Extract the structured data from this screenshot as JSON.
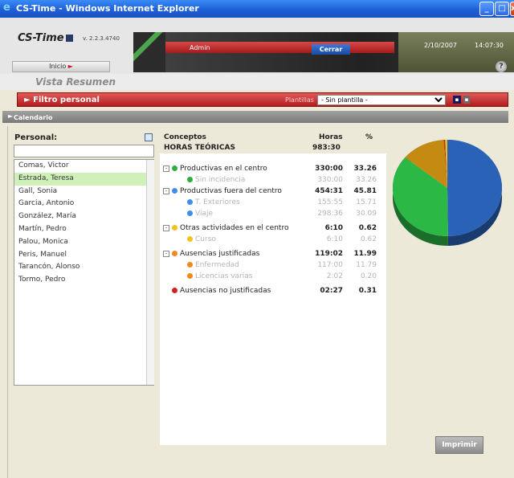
{
  "window": {
    "title": "CS-Time - Windows Internet Explorer"
  },
  "header": {
    "logo": "CS-Time",
    "version": "v. 2.2.3.4740",
    "inicio": "Inicio",
    "user": "Admin",
    "logout": "Cerrar",
    "date": "2/10/2007",
    "time": "14:07:30"
  },
  "view_title": "Vista Resumen",
  "filter": {
    "label": "Filtro personal",
    "plantillas_label": "Plantillas",
    "plantilla_value": "- Sin plantilla -"
  },
  "calendar_label": "Calendario",
  "personal": {
    "header": "Personal:",
    "search_value": "",
    "items": [
      {
        "name": "Comas, Victor",
        "selected": false
      },
      {
        "name": "Estrada, Teresa",
        "selected": true
      },
      {
        "name": "Gall, Sonia",
        "selected": false
      },
      {
        "name": "Garcia, Antonio",
        "selected": false
      },
      {
        "name": "González, María",
        "selected": false
      },
      {
        "name": "Martín, Pedro",
        "selected": false
      },
      {
        "name": "Palou, Monica",
        "selected": false
      },
      {
        "name": "Peris, Manuel",
        "selected": false
      },
      {
        "name": "Tarancón, Alonso",
        "selected": false
      },
      {
        "name": "Tormo, Pedro",
        "selected": false
      }
    ]
  },
  "conceptos": {
    "col_concepto": "Conceptos",
    "col_horas": "Horas",
    "col_pct": "%",
    "total_label": "HORAS TEÓRICAS",
    "total_horas": "983:30",
    "rows": [
      {
        "name": "Productivas en el centro",
        "horas": "330:00",
        "pct": "33.26",
        "level": 0,
        "expander": "-",
        "color": "#2eae3a",
        "style": "bold"
      },
      {
        "name": "Sin incidencia",
        "horas": "330:00",
        "pct": "33.26",
        "level": 1,
        "expander": "",
        "color": "#2eae3a",
        "style": "light"
      },
      {
        "name": "Productivas fuera del centro",
        "horas": "454:31",
        "pct": "45.81",
        "level": 0,
        "expander": "-",
        "color": "#3d8ef0",
        "style": "bold"
      },
      {
        "name": "T. Exteriores",
        "horas": "155:55",
        "pct": "15.71",
        "level": 1,
        "expander": "",
        "color": "#3d8ef0",
        "style": "light"
      },
      {
        "name": "Viaje",
        "horas": "298:36",
        "pct": "30.09",
        "level": 1,
        "expander": "",
        "color": "#3d8ef0",
        "style": "light"
      },
      {
        "name": "Otras actividades en el centro",
        "horas": "6:10",
        "pct": "0.62",
        "level": 0,
        "expander": "-",
        "color": "#f2c21a",
        "style": "bold"
      },
      {
        "name": "Curso",
        "horas": "6:10",
        "pct": "0.62",
        "level": 1,
        "expander": "",
        "color": "#f2c21a",
        "style": "light"
      },
      {
        "name": "Ausencias justificadas",
        "horas": "119:02",
        "pct": "11.99",
        "level": 0,
        "expander": "-",
        "color": "#f08a20",
        "style": "bold"
      },
      {
        "name": "Enfermedad",
        "horas": "117:00",
        "pct": "11.79",
        "level": 1,
        "expander": "",
        "color": "#f08a20",
        "style": "light"
      },
      {
        "name": "Licencias varias",
        "horas": "2:02",
        "pct": "0.20",
        "level": 1,
        "expander": "",
        "color": "#f08a20",
        "style": "light"
      },
      {
        "name": "Ausencias no justificadas",
        "horas": "02:27",
        "pct": "0.31",
        "level": 0,
        "expander": "",
        "color": "#d42020",
        "style": "bold"
      }
    ]
  },
  "chart_data": {
    "type": "pie",
    "values": [
      45.81,
      33.26,
      11.99,
      0.31,
      0.62
    ],
    "colors": [
      "#2a62b8",
      "#2bb845",
      "#c48a12",
      "#cc2222",
      "#e0c020"
    ]
  },
  "print_button": "Imprimir"
}
